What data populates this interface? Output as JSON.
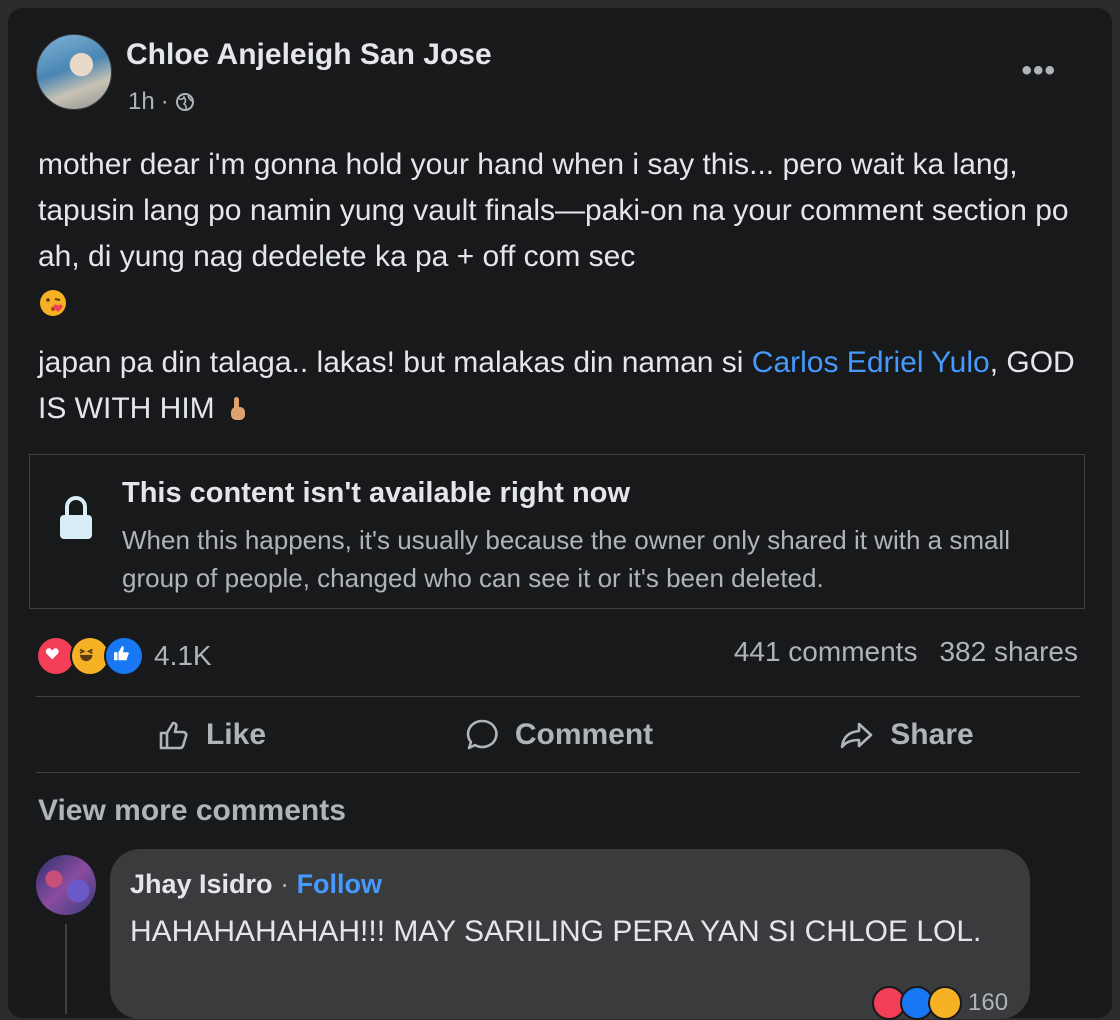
{
  "post": {
    "author": "Chloe Anjeleigh San Jose",
    "time": "1h",
    "separator": "·",
    "more_label": "•••",
    "text_p1": "mother dear i'm gonna hold your hand when i say this... pero wait ka lang, tapusin lang po namin yung vault finals—paki-on na your comment section po ah, di yung nag dedelete ka pa + off com sec",
    "text_p2_before": "japan pa din talaga.. lakas! but malakas din naman si ",
    "text_p2_link": "Carlos Edriel Yulo",
    "text_p2_after": ", GOD IS WITH HIM",
    "emojis": [
      "kissing-heart-emoji",
      "pointing-up-emoji"
    ]
  },
  "unavailable": {
    "title": "This content isn't available right now",
    "description": "When this happens, it's usually because the owner only shared it with a small group of people, changed who can see it or it's been deleted."
  },
  "stats": {
    "reaction_count": "4.1K",
    "comments": "441 comments",
    "shares": "382 shares",
    "reaction_types": [
      "love",
      "haha",
      "like"
    ]
  },
  "actions": {
    "like": "Like",
    "comment": "Comment",
    "share": "Share"
  },
  "comments_section": {
    "view_more": "View more comments",
    "comment": {
      "name": "Jhay Isidro",
      "separator": " · ",
      "follow": "Follow",
      "text": "HAHAHAHAHAH!!! MAY SARILING PERA YAN SI CHLOE LOL.",
      "reaction_count": "160"
    }
  },
  "colors": {
    "background": "#18191a",
    "link": "#4599ff",
    "secondary_text": "#b0b3b8",
    "love": "#f33e58",
    "haha": "#f7b125",
    "like": "#1877f2"
  }
}
